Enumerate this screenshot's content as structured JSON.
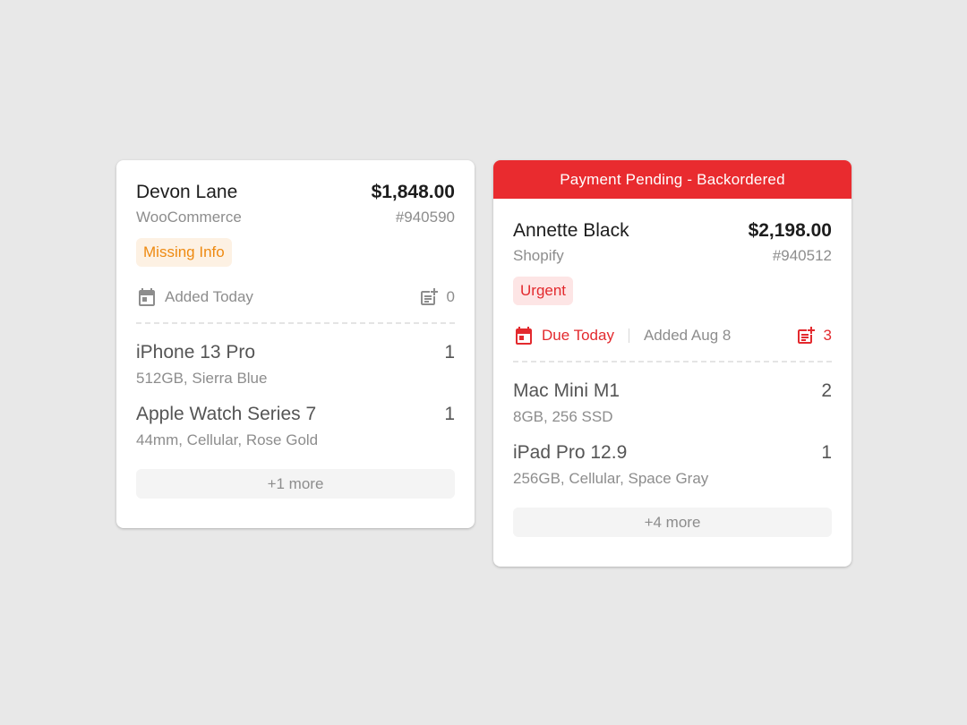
{
  "orders": [
    {
      "banner": null,
      "customer": "Devon Lane",
      "total": "$1,848.00",
      "store": "WooCommerce",
      "order_number": "#940590",
      "badge": "Missing Info",
      "due": null,
      "added": "Added Today",
      "notes_count": "0",
      "items": [
        {
          "name": "iPhone 13 Pro",
          "qty": "1",
          "desc": "512GB, Sierra Blue"
        },
        {
          "name": "Apple Watch Series 7",
          "qty": "1",
          "desc": "44mm, Cellular, Rose Gold"
        }
      ],
      "more": "+1 more"
    },
    {
      "banner": "Payment Pending - Backordered",
      "customer": "Annette Black",
      "total": "$2,198.00",
      "store": "Shopify",
      "order_number": "#940512",
      "badge": "Urgent",
      "due": "Due Today",
      "added": "Added Aug 8",
      "notes_count": "3",
      "items": [
        {
          "name": "Mac Mini M1",
          "qty": "2",
          "desc": "8GB, 256 SSD"
        },
        {
          "name": "iPad Pro 12.9",
          "qty": "1",
          "desc": "256GB, Cellular, Space Gray"
        }
      ],
      "more": "+4 more"
    }
  ],
  "colors": {
    "banner_red": "#e92b2f",
    "urgent_text": "#e32a2e",
    "urgent_bg": "#fde5e5",
    "warning_text": "#ee8a11",
    "warning_bg": "#fdf1e3",
    "muted": "#8d8d8d"
  },
  "icons": {
    "calendar": "calendar-icon",
    "notes": "note-add-icon"
  }
}
